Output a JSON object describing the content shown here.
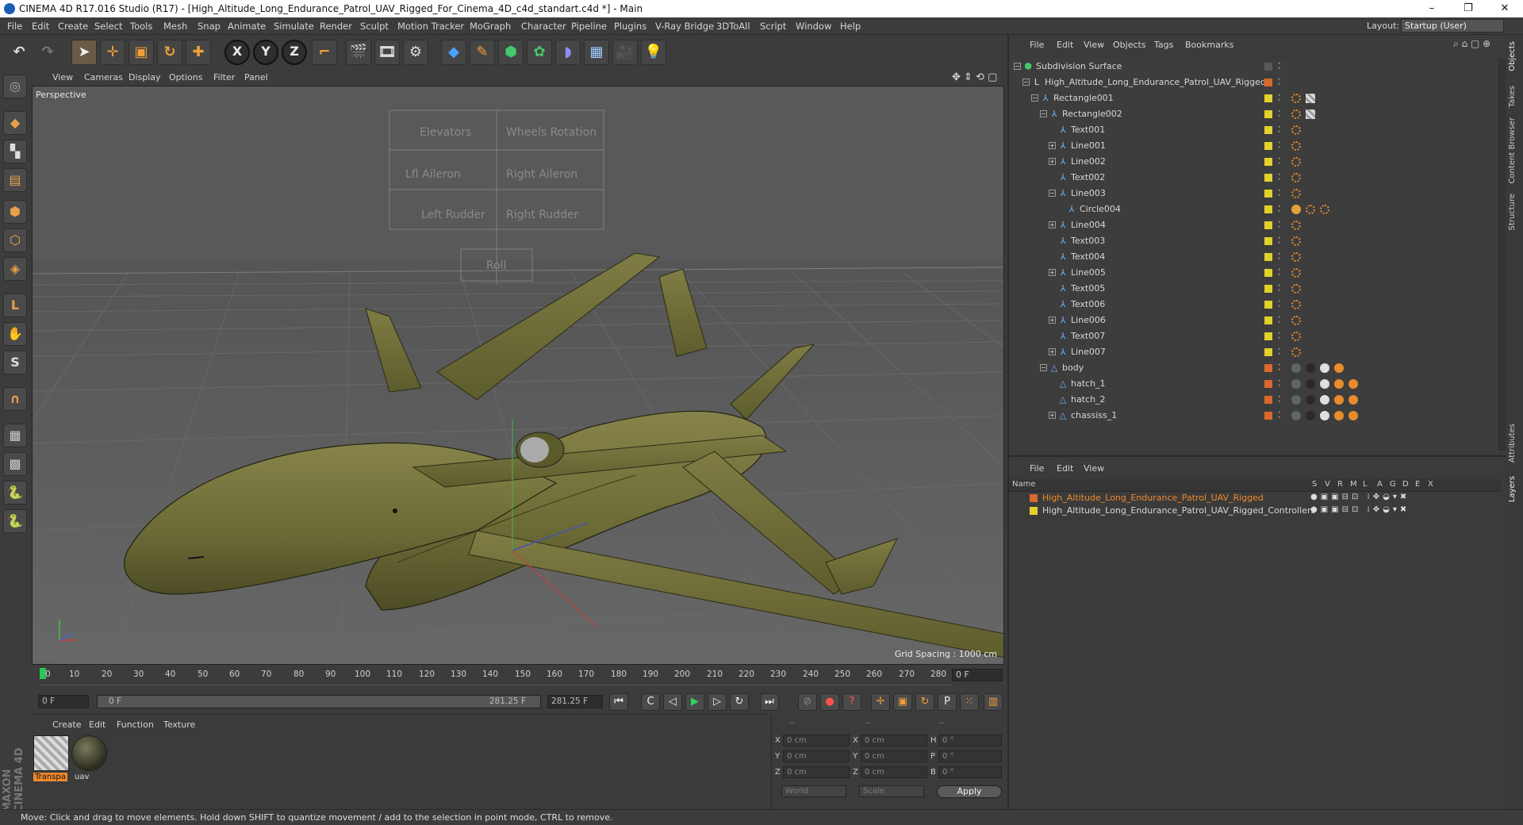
{
  "window": {
    "title": "CINEMA 4D R17.016 Studio (R17) - [High_Altitude_Long_Endurance_Patrol_UAV_Rigged_For_Cinema_4D_c4d_standart.c4d *] - Main",
    "controls": [
      "–",
      "❐",
      "✕"
    ]
  },
  "menubar": {
    "items": [
      "File",
      "Edit",
      "Create",
      "Select",
      "Tools",
      "Mesh",
      "Snap",
      "Animate",
      "Simulate",
      "Render",
      "Sculpt",
      "Motion Tracker",
      "MoGraph",
      "Character",
      "Pipeline",
      "Plugins",
      "V-Ray Bridge",
      "3DToAll",
      "Script",
      "Window",
      "Help"
    ],
    "layout_label": "Layout:",
    "layout_value": "Startup (User)"
  },
  "toolbar": {
    "icons": [
      "undo-icon",
      "redo-icon",
      "select-arrow-icon",
      "move-icon",
      "scale-icon",
      "rotate-icon",
      "live-select-icon",
      "x-axis-icon",
      "y-axis-icon",
      "z-axis-icon",
      "coordinate-system-icon",
      "render-view-icon",
      "render-picture-viewer-icon",
      "edit-render-settings-icon",
      "cube-icon",
      "pen-spline-icon",
      "subdivision-icon",
      "array-icon",
      "deformer-icon",
      "floor-icon",
      "camera-icon",
      "light-icon"
    ],
    "axis_labels": [
      "X",
      "Y",
      "Z"
    ]
  },
  "viewport": {
    "menu": [
      "View",
      "Cameras",
      "Display",
      "Options",
      "Filter",
      "Panel"
    ],
    "label": "Perspective",
    "grid_spacing": "Grid Spacing : 1000 cm",
    "overlay_texts": [
      "Elevators",
      "Wheels Rotation",
      "Lfl Aileron",
      "Right Aileron",
      "Left Rudder",
      "Right Rudder",
      "Roll"
    ]
  },
  "timeline": {
    "ticks": [
      "0",
      "10",
      "20",
      "30",
      "40",
      "50",
      "60",
      "70",
      "80",
      "90",
      "100",
      "110",
      "120",
      "130",
      "140",
      "150",
      "160",
      "170",
      "180",
      "190",
      "200",
      "210",
      "220",
      "230",
      "240",
      "250",
      "260",
      "270",
      "280"
    ],
    "frame_field": "0 F",
    "start_field": "0 F",
    "slider_left": "0 F",
    "slider_right": "281.25 F",
    "end_field": "281.25 F"
  },
  "materials": {
    "menu": [
      "Create",
      "Edit",
      "Function",
      "Texture"
    ],
    "items": [
      {
        "name": "Transpa",
        "selected": true
      },
      {
        "name": "uav",
        "selected": false
      }
    ]
  },
  "attributes": {
    "header": [
      "--",
      "--",
      "--"
    ],
    "rows": [
      {
        "a": "X",
        "v1": "0 cm",
        "b": "X",
        "v2": "0 cm",
        "c": "H",
        "v3": "0 °"
      },
      {
        "a": "Y",
        "v1": "0 cm",
        "b": "Y",
        "v2": "0 cm",
        "c": "P",
        "v3": "0 °"
      },
      {
        "a": "Z",
        "v1": "0 cm",
        "b": "Z",
        "v2": "0 cm",
        "c": "B",
        "v3": "0 °"
      }
    ],
    "coord_system": "World",
    "mode": "Scale",
    "apply": "Apply"
  },
  "object_manager": {
    "menu": [
      "File",
      "Edit",
      "View",
      "Objects",
      "Tags",
      "Bookmarks"
    ],
    "objects": [
      {
        "name": "Subdivision Surface",
        "depth": 0,
        "expanded": true,
        "icon": "subdivision-icon",
        "color": "#5a5a5a",
        "tags": 0
      },
      {
        "name": "High_Altitude_Long_Endurance_Patrol_UAV_Rigged",
        "depth": 1,
        "expanded": true,
        "icon": "null-icon",
        "color": "#d9682c",
        "tags": 0
      },
      {
        "name": "Rectangle001",
        "depth": 2,
        "expanded": true,
        "icon": "spline-icon",
        "color": "#e2d12c",
        "tags": 2
      },
      {
        "name": "Rectangle002",
        "depth": 3,
        "expanded": true,
        "icon": "spline-icon",
        "color": "#e2d12c",
        "tags": 2
      },
      {
        "name": "Text001",
        "depth": 4,
        "expanded": null,
        "icon": "spline-icon",
        "color": "#e2d12c",
        "tags": 1
      },
      {
        "name": "Line001",
        "depth": 4,
        "expanded": false,
        "icon": "spline-icon",
        "color": "#e2d12c",
        "tags": 1
      },
      {
        "name": "Line002",
        "depth": 4,
        "expanded": false,
        "icon": "spline-icon",
        "color": "#e2d12c",
        "tags": 1
      },
      {
        "name": "Text002",
        "depth": 4,
        "expanded": null,
        "icon": "spline-icon",
        "color": "#e2d12c",
        "tags": 1
      },
      {
        "name": "Line003",
        "depth": 4,
        "expanded": true,
        "icon": "spline-icon",
        "color": "#e2d12c",
        "tags": 1
      },
      {
        "name": "Circle004",
        "depth": 5,
        "expanded": null,
        "icon": "spline-icon",
        "color": "#e2d12c",
        "tags": 3
      },
      {
        "name": "Line004",
        "depth": 4,
        "expanded": false,
        "icon": "spline-icon",
        "color": "#e2d12c",
        "tags": 1
      },
      {
        "name": "Text003",
        "depth": 4,
        "expanded": null,
        "icon": "spline-icon",
        "color": "#e2d12c",
        "tags": 1
      },
      {
        "name": "Text004",
        "depth": 4,
        "expanded": null,
        "icon": "spline-icon",
        "color": "#e2d12c",
        "tags": 1
      },
      {
        "name": "Line005",
        "depth": 4,
        "expanded": false,
        "icon": "spline-icon",
        "color": "#e2d12c",
        "tags": 1
      },
      {
        "name": "Text005",
        "depth": 4,
        "expanded": null,
        "icon": "spline-icon",
        "color": "#e2d12c",
        "tags": 1
      },
      {
        "name": "Text006",
        "depth": 4,
        "expanded": null,
        "icon": "spline-icon",
        "color": "#e2d12c",
        "tags": 1
      },
      {
        "name": "Line006",
        "depth": 4,
        "expanded": false,
        "icon": "spline-icon",
        "color": "#e2d12c",
        "tags": 1
      },
      {
        "name": "Text007",
        "depth": 4,
        "expanded": null,
        "icon": "spline-icon",
        "color": "#e2d12c",
        "tags": 1
      },
      {
        "name": "Line007",
        "depth": 4,
        "expanded": false,
        "icon": "spline-icon",
        "color": "#e2d12c",
        "tags": 1
      },
      {
        "name": "body",
        "depth": 3,
        "expanded": true,
        "icon": "polygon-icon",
        "color": "#d9682c",
        "tags": 4
      },
      {
        "name": "hatch_1",
        "depth": 4,
        "expanded": null,
        "icon": "polygon-icon",
        "color": "#d9682c",
        "tags": 5
      },
      {
        "name": "hatch_2",
        "depth": 4,
        "expanded": null,
        "icon": "polygon-icon",
        "color": "#d9682c",
        "tags": 5
      },
      {
        "name": "chassiss_1",
        "depth": 4,
        "expanded": false,
        "icon": "polygon-icon",
        "color": "#d9682c",
        "tags": 5
      }
    ]
  },
  "layer_manager": {
    "menu": [
      "File",
      "Edit",
      "View"
    ],
    "header": {
      "name": "Name",
      "cols": [
        "S",
        "V",
        "R",
        "M",
        "L",
        "A",
        "G",
        "D",
        "E",
        "X"
      ]
    },
    "layers": [
      {
        "name": "High_Altitude_Long_Endurance_Patrol_UAV_Rigged",
        "color": "#d9682c",
        "text_color": "#f08a2c"
      },
      {
        "name": "High_Altitude_Long_Endurance_Patrol_UAV_Rigged_Controllers",
        "color": "#e2d12c",
        "text_color": "#d7d7d7"
      }
    ]
  },
  "side_tabs": [
    "Objects",
    "Takes",
    "Content Browser",
    "Structure",
    "Attributes",
    "Layers"
  ],
  "status": {
    "text": "Move: Click and drag to move elements. Hold down SHIFT to quantize movement / add to the selection in point mode, CTRL to remove.",
    "brand": "MAXON CINEMA 4D"
  },
  "colors": {
    "accent": "#f08a2c",
    "yellow_layer": "#e2d12c",
    "orange_layer": "#d9682c",
    "uav_body": "#6b6a36"
  }
}
